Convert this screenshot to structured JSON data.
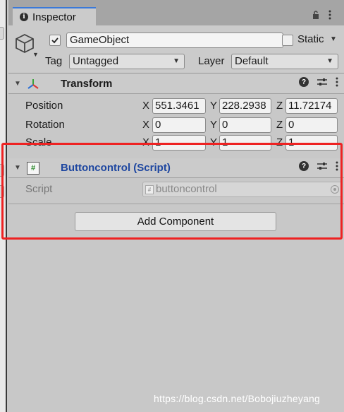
{
  "tab": {
    "title": "Inspector"
  },
  "gameobject": {
    "name": "GameObject",
    "active": true,
    "static_label": "Static",
    "static_checked": false,
    "tag_label": "Tag",
    "tag_value": "Untagged",
    "layer_label": "Layer",
    "layer_value": "Default"
  },
  "transform": {
    "title": "Transform",
    "rows": [
      {
        "label": "Position",
        "x": "551.3461",
        "y": "228.2938",
        "z": "11.72174"
      },
      {
        "label": "Rotation",
        "x": "0",
        "y": "0",
        "z": "0"
      },
      {
        "label": "Scale",
        "x": "1",
        "y": "1",
        "z": "1"
      }
    ],
    "axis": {
      "x": "X",
      "y": "Y",
      "z": "Z"
    }
  },
  "script_component": {
    "title": "Buttoncontrol (Script)",
    "icon_glyph": "#",
    "script_label": "Script",
    "script_value": "buttoncontrol"
  },
  "add_component": {
    "label": "Add Component"
  },
  "watermark": "https://blog.csdn.net/Bobojiuzheyang",
  "colors": {
    "highlight_box": "#ee2222",
    "script_title": "#1d46a0",
    "tab_accent": "#3a79d8"
  },
  "icons": [
    "info-icon",
    "lock-icon",
    "menu-icon",
    "cube-icon",
    "checkmark-icon",
    "transform-axes-icon",
    "help-icon",
    "preset-sliders-icon",
    "kebab-menu-icon",
    "script-hash-icon",
    "object-picker-icon"
  ]
}
